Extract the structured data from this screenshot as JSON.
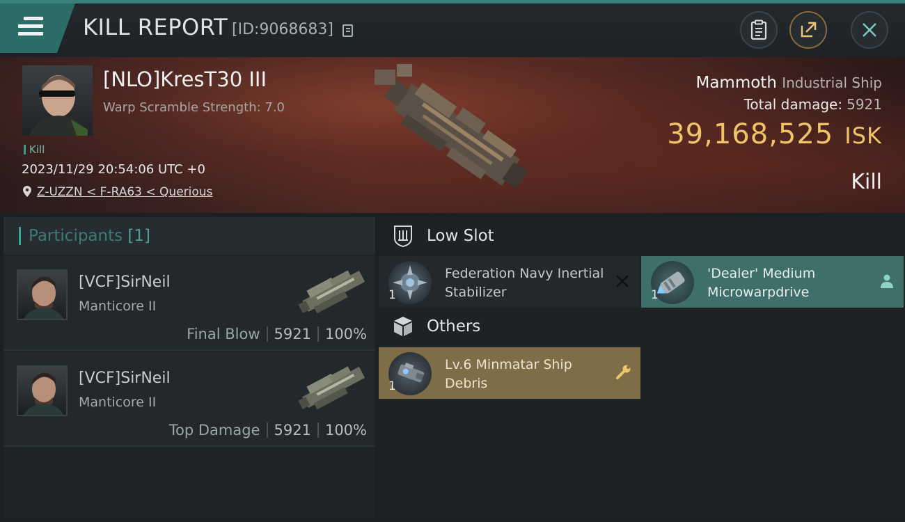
{
  "header": {
    "title": "KILL REPORT",
    "kill_id": "[ID:9068683]"
  },
  "victim": {
    "name": "[NLO]KresT30 III",
    "warp_scramble": "Warp Scramble Strength: 7.0",
    "tag": "Kill",
    "datetime": "2023/11/29 20:54:06 UTC +0",
    "location": "Z-UZZN < F-RA63 < Querious",
    "ship_name": "Mammoth",
    "ship_class": "Industrial Ship",
    "total_damage_label": "Total damage:",
    "total_damage": "5921",
    "isk_value": "39,168,525",
    "isk_unit": "ISK",
    "result": "Kill"
  },
  "participants": {
    "label": "Participants",
    "count": "[1]",
    "rows": [
      {
        "name": "[VCF]SirNeil",
        "ship": "Manticore II",
        "role": "Final Blow",
        "damage": "5921",
        "percent": "100%"
      },
      {
        "name": "[VCF]SirNeil",
        "ship": "Manticore II",
        "role": "Top Damage",
        "damage": "5921",
        "percent": "100%"
      }
    ]
  },
  "slots": {
    "low_slot_title": "Low Slot",
    "others_title": "Others",
    "low_items": [
      {
        "name": "Federation Navy Inertial Stabilizer",
        "qty": "1",
        "state": "destroyed"
      },
      {
        "name": "'Dealer' Medium Microwarpdrive",
        "qty": "1",
        "state": "dropped"
      }
    ],
    "other_items": [
      {
        "name": "Lv.6 Minmatar Ship Debris",
        "qty": "1",
        "state": "dropped"
      }
    ]
  },
  "colors": {
    "accent_teal": "#3a7f78",
    "isk_gold": "#f0c468",
    "dropped_item_bg": "#3f6f6a",
    "debris_item_bg": "#7d6e48"
  }
}
